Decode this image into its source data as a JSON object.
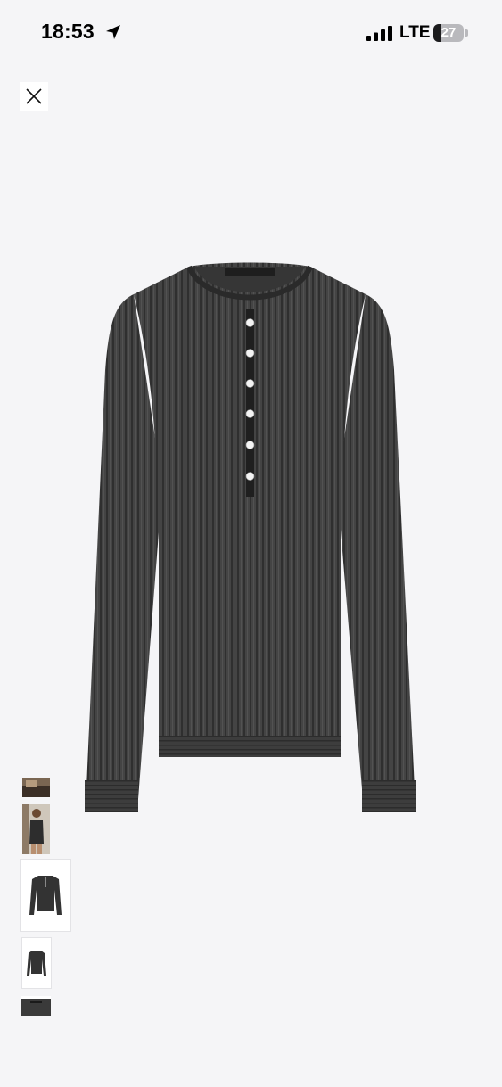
{
  "status_bar": {
    "time": "18:53",
    "location_icon": "location-arrow-icon",
    "signal_icon": "cellular-signal-icon",
    "network": "LTE",
    "battery_level": "27",
    "battery_fraction": 0.27
  },
  "header": {
    "close_icon": "close-icon"
  },
  "product": {
    "image_description_icon": "henley-sweater-image",
    "colors": {
      "knit_dark": "#3a3a3a",
      "knit_mid": "#4a4a4a",
      "button_white": "#f4f4f4",
      "background": "#f5f5f7"
    }
  },
  "thumbnails": [
    {
      "name": "thumbnail-detail"
    },
    {
      "name": "thumbnail-model"
    },
    {
      "name": "thumbnail-front",
      "selected": true
    },
    {
      "name": "thumbnail-back"
    },
    {
      "name": "thumbnail-label"
    }
  ]
}
